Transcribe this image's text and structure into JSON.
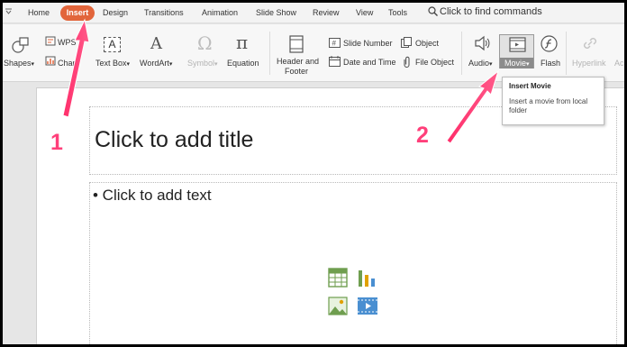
{
  "menubar": {
    "items": [
      "Home",
      "Insert",
      "Design",
      "Transitions",
      "Animation",
      "Slide Show",
      "Review",
      "View",
      "Tools"
    ],
    "search_placeholder": "Click to find commands"
  },
  "ribbon": {
    "shapes": "Shapes",
    "wps": "WPS",
    "chart": "Chart",
    "textbox": "Text Box",
    "wordart": "WordArt",
    "symbol": "Symbol",
    "equation": "Equation",
    "header_footer_1": "Header and",
    "header_footer_2": "Footer",
    "slide_number": "Slide Number",
    "date_time": "Date and Time",
    "object": "Object",
    "file_object": "File Object",
    "audio": "Audio",
    "movie": "Movie",
    "flash": "Flash",
    "hyperlink": "Hyperlink",
    "ac": "Ac",
    "symbol_glyph": "Ω",
    "equation_glyph": "π",
    "textbox_glyph": "A",
    "wordart_glyph": "A",
    "dropdown_glyph": "▾"
  },
  "tooltip": {
    "title": "Insert Movie",
    "description": "Insert a movie from local folder"
  },
  "slide": {
    "title_placeholder": "Click to add title",
    "content_placeholder": "• Click to add text"
  },
  "annotations": {
    "step1": "1",
    "step2": "2"
  },
  "colors": {
    "accent": "#e2653b",
    "callout": "#ff3f7a"
  }
}
